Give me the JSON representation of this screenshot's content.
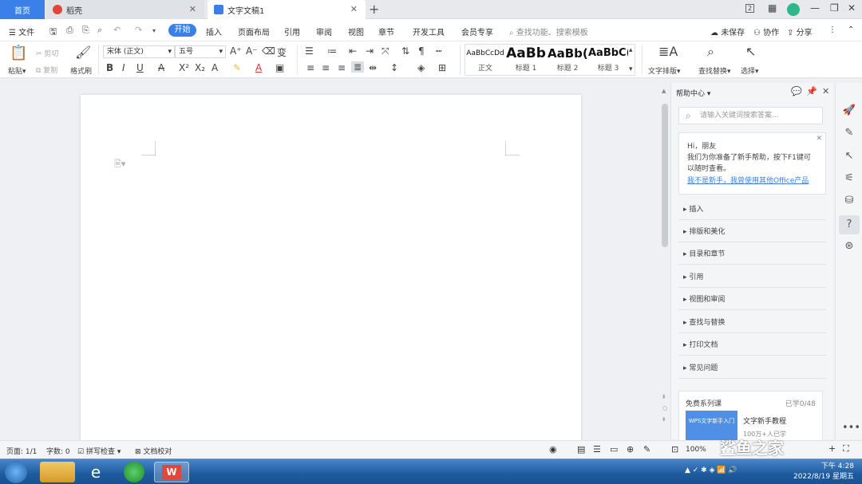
{
  "tabs": {
    "home": "首页",
    "daoke": "稻壳",
    "document": "文字文稿1"
  },
  "menu": {
    "file": "文件",
    "items": [
      "开始",
      "插入",
      "页面布局",
      "引用",
      "审阅",
      "视图",
      "章节",
      "开发工具",
      "会员专享"
    ],
    "search_placeholder": "查找功能、搜索模板",
    "unsaved": "未保存",
    "collab": "协作",
    "share": "分享"
  },
  "ribbon": {
    "paste": "粘贴",
    "cut": "剪切",
    "copy": "复制",
    "format_painter": "格式刷",
    "font_name": "宋体 (正文)",
    "font_size": "五号",
    "styles": [
      {
        "preview": "AaBbCcDd",
        "label": "正文"
      },
      {
        "preview": "AaBb",
        "label": "标题 1"
      },
      {
        "preview": "AaBb(",
        "label": "标题 2"
      },
      {
        "preview": "AaBbC(",
        "label": "标题 3"
      }
    ],
    "text_layout": "文字排版",
    "find_replace": "查找替换",
    "select": "选择"
  },
  "help_panel": {
    "title": "帮助中心",
    "search_placeholder": "请输入关键词搜索答案...",
    "greeting_title": "Hi，朋友",
    "greeting_body": "我们为你准备了新手帮助，按下F1键可以随时查看。",
    "greeting_link": "我不是新手，我曾使用其他Office产品",
    "sections": [
      "插入",
      "排版和美化",
      "目录和章节",
      "引用",
      "视图和审阅",
      "查找与替换",
      "打印文档",
      "常见问题"
    ],
    "course_header": "免费系列课",
    "course_progress": "已学0/48",
    "course_title": "文字新手教程",
    "course_students": "100万+人已学",
    "course_thumb": "WPS文字新手入门"
  },
  "status": {
    "page": "页面: 1/1",
    "words": "字数: 0",
    "spellcheck": "拼写检查",
    "proofread": "文档校对",
    "zoom": "100%"
  },
  "watermark": "鲨鱼之家",
  "clock": {
    "time": "下午 4:28",
    "date": "2022/8/19 星期五"
  },
  "colors": {
    "accent": "#3b80e8",
    "taskbar": "#1d5a9e"
  }
}
